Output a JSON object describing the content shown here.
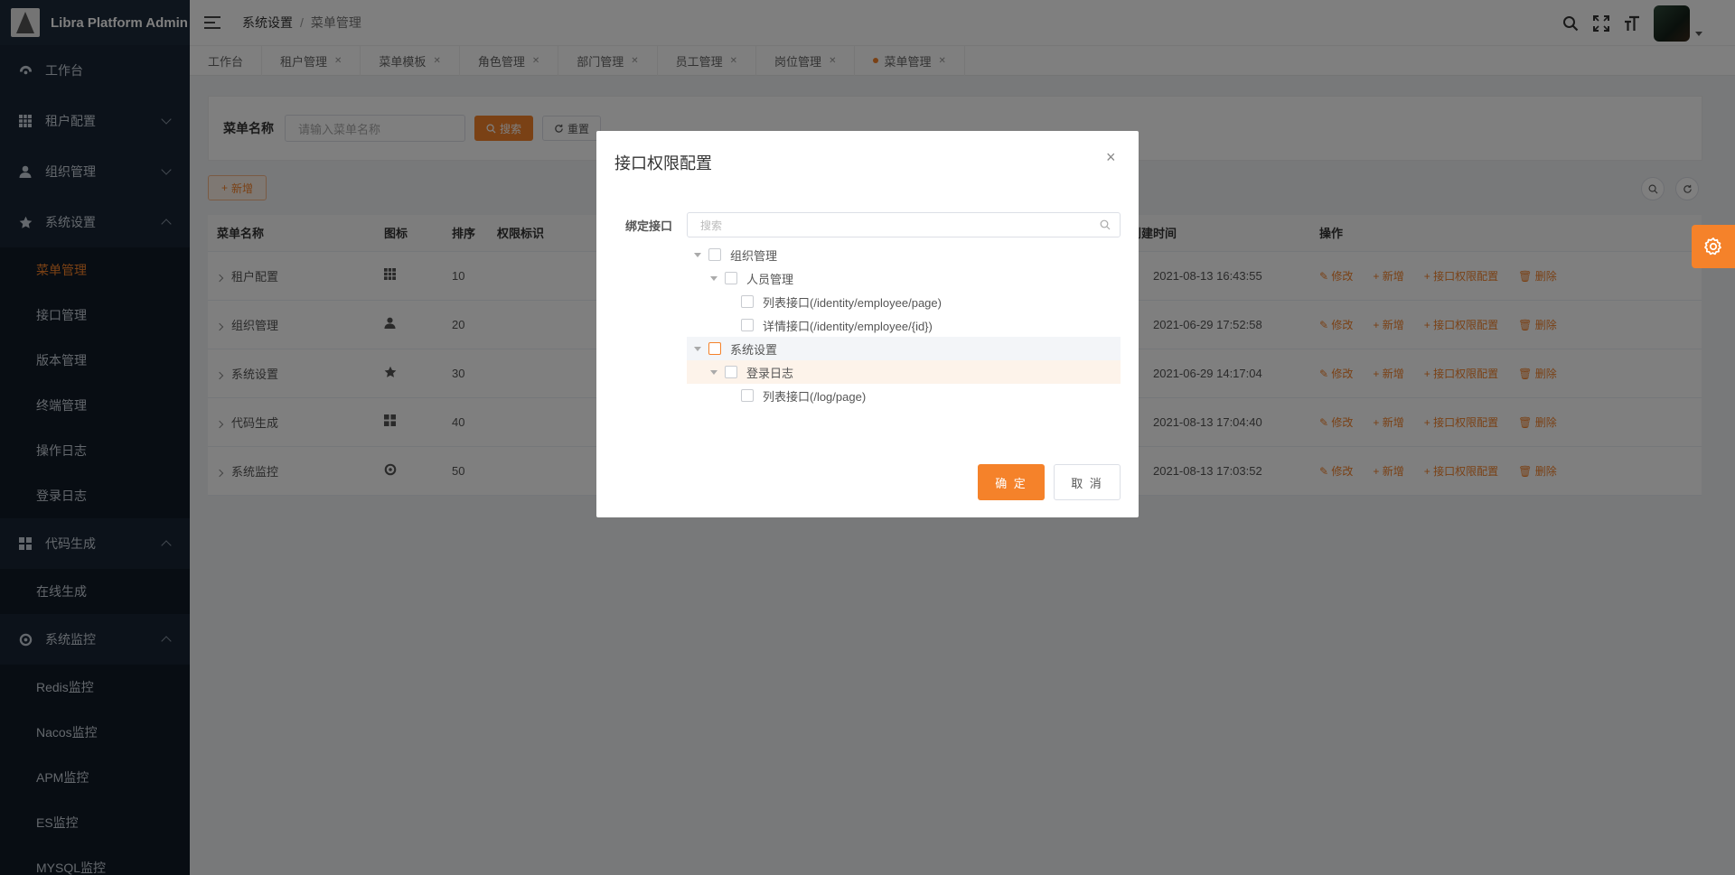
{
  "app": {
    "title": "Libra Platform Admin"
  },
  "sidebar": {
    "items": [
      {
        "label": "工作台",
        "icon": "dashboard-icon"
      },
      {
        "label": "租户配置",
        "icon": "grid-icon"
      },
      {
        "label": "组织管理",
        "icon": "user-icon"
      },
      {
        "label": "系统设置",
        "icon": "star-icon",
        "children": [
          "菜单管理",
          "接口管理",
          "版本管理",
          "终端管理",
          "操作日志",
          "登录日志"
        ],
        "active_child": "菜单管理"
      },
      {
        "label": "代码生成",
        "icon": "apps-icon",
        "children": [
          "在线生成"
        ]
      },
      {
        "label": "系统监控",
        "icon": "monitor-icon",
        "children": [
          "Redis监控",
          "Nacos监控",
          "APM监控",
          "ES监控",
          "MYSQL监控"
        ]
      }
    ]
  },
  "header": {
    "breadcrumb": [
      "系统设置",
      "菜单管理"
    ]
  },
  "tabs": [
    {
      "label": "工作台",
      "closable": false,
      "active": false
    },
    {
      "label": "租户管理",
      "closable": true,
      "active": false
    },
    {
      "label": "菜单模板",
      "closable": true,
      "active": false
    },
    {
      "label": "角色管理",
      "closable": true,
      "active": false
    },
    {
      "label": "部门管理",
      "closable": true,
      "active": false
    },
    {
      "label": "员工管理",
      "closable": true,
      "active": false
    },
    {
      "label": "岗位管理",
      "closable": true,
      "active": false
    },
    {
      "label": "菜单管理",
      "closable": true,
      "active": true
    }
  ],
  "search": {
    "label": "菜单名称",
    "placeholder": "请输入菜单名称",
    "search_btn": "搜索",
    "reset_btn": "重置"
  },
  "toolbar": {
    "add_btn": "新增"
  },
  "table": {
    "columns": [
      "菜单名称",
      "图标",
      "排序",
      "权限标识",
      "创建时间",
      "操作"
    ],
    "rows": [
      {
        "name": "租户配置",
        "icon": "grid-icon",
        "sort": "10",
        "perm": "",
        "created": "2021-08-13 16:43:55"
      },
      {
        "name": "组织管理",
        "icon": "user-icon",
        "sort": "20",
        "perm": "",
        "created": "2021-06-29 17:52:58"
      },
      {
        "name": "系统设置",
        "icon": "star-icon",
        "sort": "30",
        "perm": "",
        "created": "2021-06-29 14:17:04"
      },
      {
        "name": "代码生成",
        "icon": "apps-icon",
        "sort": "40",
        "perm": "",
        "created": "2021-08-13 17:04:40"
      },
      {
        "name": "系统监控",
        "icon": "monitor-icon",
        "sort": "50",
        "perm": "",
        "created": "2021-08-13 17:03:52"
      }
    ],
    "actions": [
      "修改",
      "新增",
      "接口权限配置",
      "删除"
    ]
  },
  "modal": {
    "title": "接口权限配置",
    "bind_label": "绑定接口",
    "search_placeholder": "搜索",
    "tree": [
      {
        "label": "组织管理",
        "level": 0,
        "expanded": true
      },
      {
        "label": "人员管理",
        "level": 1,
        "expanded": true
      },
      {
        "label": "列表接口(/identity/employee/page)",
        "level": 2
      },
      {
        "label": "详情接口(/identity/employee/{id})",
        "level": 2
      },
      {
        "label": "系统设置",
        "level": 0,
        "expanded": true,
        "highlight": "blue"
      },
      {
        "label": "登录日志",
        "level": 1,
        "expanded": true,
        "highlight": "orange"
      },
      {
        "label": "列表接口(/log/page)",
        "level": 2
      }
    ],
    "ok_btn": "确 定",
    "cancel_btn": "取 消"
  },
  "colors": {
    "accent": "#f5822a",
    "sidebar_bg": "#182535"
  }
}
